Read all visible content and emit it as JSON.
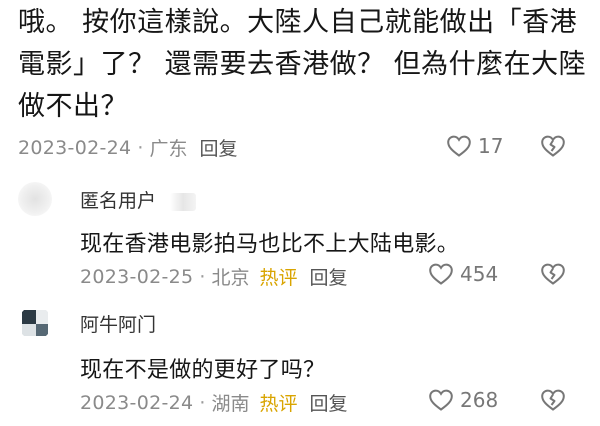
{
  "main_comment": {
    "text": "哦。 按你這樣說。大陸人自己就能做出「香港電影」了？ 還需要去香港做？ 但為什麼在大陸做不出？",
    "date": "2023-02-24",
    "separator": "·",
    "location": "广东",
    "reply_label": "回复",
    "likes": "17"
  },
  "replies": [
    {
      "username": "匿名用户",
      "text": "现在香港电影拍马也比不上大陆电影。",
      "date": "2023-02-25",
      "separator": "·",
      "location": "北京",
      "hot_label": "热评",
      "reply_label": "回复",
      "likes": "454"
    },
    {
      "username": "阿牛阿门",
      "text": "现在不是做的更好了吗？",
      "date": "2023-02-24",
      "separator": "·",
      "location": "湖南",
      "hot_label": "热评",
      "reply_label": "回复",
      "likes": "268"
    }
  ],
  "icons": {
    "like": "heart-icon",
    "dislike": "broken-heart-icon"
  },
  "colors": {
    "text": "#161616",
    "meta": "#8a8a8a",
    "hot": "#d9a400",
    "icon": "#777777"
  }
}
